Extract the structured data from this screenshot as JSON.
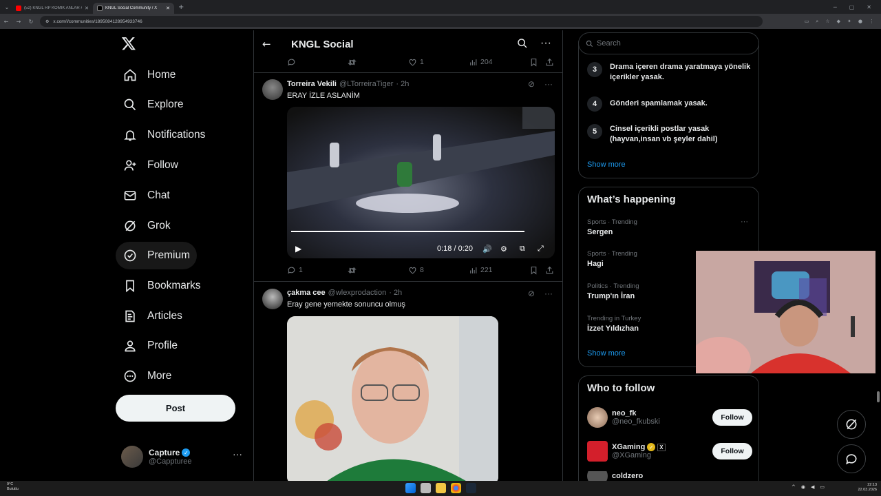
{
  "browser": {
    "tabs": [
      {
        "title": "(52) KNGL RP KOMİK ANLAR #...",
        "active": false
      },
      {
        "title": "KNGL Social Community / X",
        "active": true
      }
    ],
    "url": "x.com/i/communities/1895084128954933746"
  },
  "nav": {
    "items": [
      {
        "label": "Home",
        "icon": "home-icon"
      },
      {
        "label": "Explore",
        "icon": "search-icon"
      },
      {
        "label": "Notifications",
        "icon": "bell-icon"
      },
      {
        "label": "Follow",
        "icon": "follow-icon"
      },
      {
        "label": "Chat",
        "icon": "mail-icon"
      },
      {
        "label": "Grok",
        "icon": "grok-icon"
      },
      {
        "label": "Premium",
        "icon": "premium-icon"
      },
      {
        "label": "Bookmarks",
        "icon": "bookmark-icon"
      },
      {
        "label": "Articles",
        "icon": "articles-icon"
      },
      {
        "label": "Profile",
        "icon": "profile-icon"
      },
      {
        "label": "More",
        "icon": "more-icon"
      }
    ],
    "post_label": "Post",
    "account": {
      "name": "Capture",
      "handle": "@Cappturee"
    }
  },
  "header": {
    "title": "KNGL Social"
  },
  "feed": {
    "top_actions": {
      "replies": "",
      "likes": "1",
      "views": "204"
    },
    "tweets": [
      {
        "name": "Torreira Vekili",
        "handle": "@LTorreiraTiger",
        "time": "· 2h",
        "text": "ERAY İZLE ASLANİM",
        "video": {
          "time": "0:18 / 0:20",
          "progress": 0.9
        },
        "replies": "1",
        "likes": "8",
        "views": "221"
      },
      {
        "name": "çakma cee",
        "handle": "@wlexprodaction",
        "time": "· 2h",
        "text": "Eray gene yemekte sonuncu olmuş"
      }
    ]
  },
  "sidebar": {
    "search_placeholder": "Search",
    "rules": [
      {
        "num": "3",
        "text": "Drama içeren drama yaratmaya yönelik içerikler yasak."
      },
      {
        "num": "4",
        "text": "Gönderi spamlamak yasak."
      },
      {
        "num": "5",
        "text": "Cinsel içerikli postlar yasak (hayvan,insan vb şeyler dahil)"
      }
    ],
    "show_more": "Show more",
    "happening_title": "What’s happening",
    "trends": [
      {
        "meta": "Sports · Trending",
        "name": "Sergen"
      },
      {
        "meta": "Sports · Trending",
        "name": "Hagi"
      },
      {
        "meta": "Politics · Trending",
        "name": "Trump'ın İran"
      },
      {
        "meta": "Trending in Turkey",
        "name": "İzzet Yıldızhan"
      }
    ],
    "who_title": "Who to follow",
    "who": [
      {
        "name": "neo_fk",
        "handle": "@neo_fkubski",
        "button": "Follow"
      },
      {
        "name": "XGaming",
        "handle": "@XGaming",
        "button": "Follow"
      },
      {
        "name": "coldzero",
        "handle": "",
        "button": ""
      }
    ]
  },
  "taskbar": {
    "weather_temp": "9°C",
    "weather_desc": "Bulutlu",
    "time": "22:13",
    "date": "22.03.2026"
  },
  "colors": {
    "accent": "#1d9bf0",
    "bg": "#000000",
    "border": "#2f3336",
    "muted": "#71767b"
  }
}
